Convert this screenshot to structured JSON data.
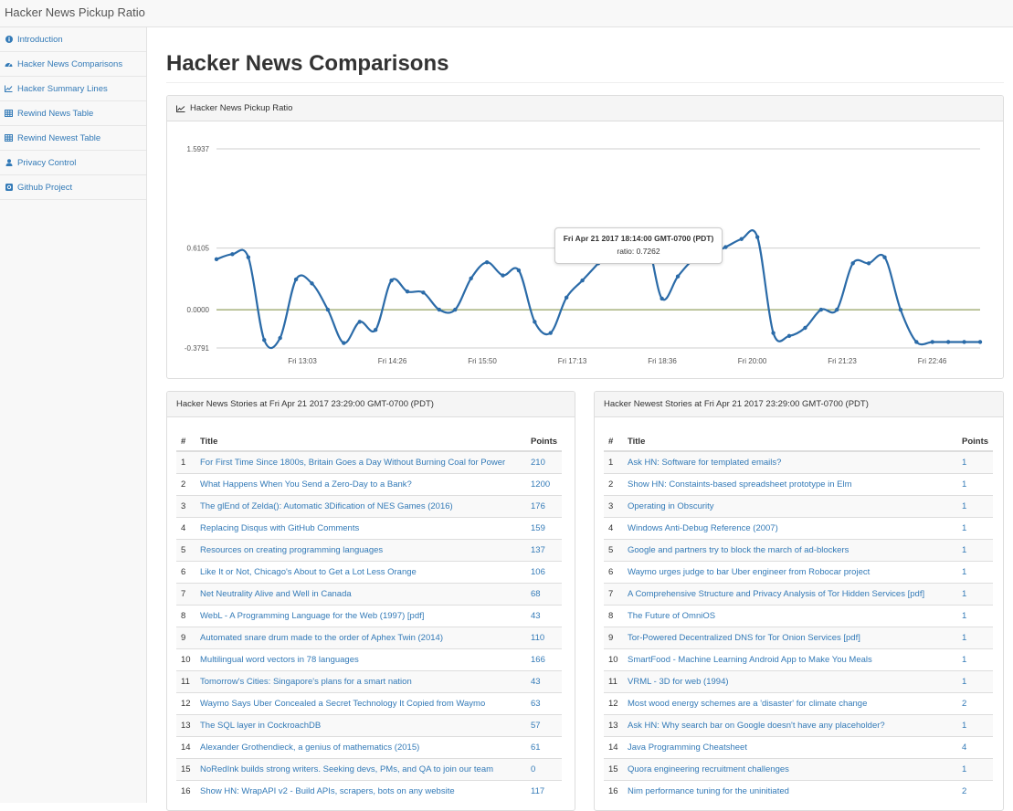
{
  "app": {
    "title": "Hacker News Pickup Ratio"
  },
  "sidebar": {
    "items": [
      {
        "label": "Introduction",
        "icon": "info-icon"
      },
      {
        "label": "Hacker News Comparisons",
        "icon": "dashboard-icon"
      },
      {
        "label": "Hacker Summary Lines",
        "icon": "line-chart-icon"
      },
      {
        "label": "Rewind News Table",
        "icon": "table-icon"
      },
      {
        "label": "Rewind Newest Table",
        "icon": "table-icon"
      },
      {
        "label": "Privacy Control",
        "icon": "user-icon"
      },
      {
        "label": "Github Project",
        "icon": "github-icon"
      }
    ]
  },
  "main": {
    "title": "Hacker News Comparisons"
  },
  "chart_panel": {
    "heading": "Hacker News Pickup Ratio"
  },
  "chart_data": {
    "type": "line",
    "title": "",
    "xlabel": "",
    "ylabel": "",
    "yticks": [
      "1.5937",
      "0.6105",
      "0.0000",
      "-0.3791"
    ],
    "ylim": [
      -0.3791,
      1.5937
    ],
    "xticks": [
      "Fri 13:03",
      "Fri 14:26",
      "Fri 15:50",
      "Fri 17:13",
      "Fri 18:36",
      "Fri 20:00",
      "Fri 21:23",
      "Fri 22:46"
    ],
    "grid": true,
    "line_color": "#2b6ba8",
    "series": [
      {
        "values": [
          0.5,
          0.55,
          0.52,
          -0.3,
          -0.28,
          0.3,
          0.26,
          0.0,
          -0.33,
          -0.12,
          -0.2,
          0.29,
          0.18,
          0.17,
          0.0,
          0.0,
          0.31,
          0.47,
          0.34,
          0.39,
          -0.12,
          -0.23,
          0.12,
          0.29,
          0.46,
          0.64,
          0.65,
          0.7262,
          0.11,
          0.33,
          0.5,
          0.55,
          0.62,
          0.7,
          0.72,
          -0.23,
          -0.26,
          -0.18,
          0.0,
          0.0,
          0.46,
          0.46,
          0.52,
          0.0,
          -0.32,
          -0.32,
          -0.32,
          -0.32,
          -0.32
        ]
      }
    ],
    "tooltip": {
      "date": "Fri Apr 21 2017 18:14:00 GMT-0700 (PDT)",
      "text": "ratio: 0.7262",
      "point_index": 27
    }
  },
  "stories": {
    "heading": "Hacker News Stories at Fri Apr 21 2017 23:29:00 GMT-0700 (PDT)",
    "columns": [
      "#",
      "Title",
      "Points"
    ],
    "rows": [
      [
        "1",
        "For First Time Since 1800s, Britain Goes a Day Without Burning Coal for Power",
        "210"
      ],
      [
        "2",
        "What Happens When You Send a Zero-Day to a Bank?",
        "1200"
      ],
      [
        "3",
        "The glEnd of Zelda(): Automatic 3Dification of NES Games (2016)",
        "176"
      ],
      [
        "4",
        "Replacing Disqus with GitHub Comments",
        "159"
      ],
      [
        "5",
        "Resources on creating programming languages",
        "137"
      ],
      [
        "6",
        "Like It or Not, Chicago's About to Get a Lot Less Orange",
        "106"
      ],
      [
        "7",
        "Net Neutrality Alive and Well in Canada",
        "68"
      ],
      [
        "8",
        "WebL - A Programming Language for the Web (1997) [pdf]",
        "43"
      ],
      [
        "9",
        "Automated snare drum made to the order of Aphex Twin (2014)",
        "110"
      ],
      [
        "10",
        "Multilingual word vectors in 78 languages",
        "166"
      ],
      [
        "11",
        "Tomorrow's Cities: Singapore's plans for a smart nation",
        "43"
      ],
      [
        "12",
        "Waymo Says Uber Concealed a Secret Technology It Copied from Waymo",
        "63"
      ],
      [
        "13",
        "The SQL layer in CockroachDB",
        "57"
      ],
      [
        "14",
        "Alexander Grothendieck, a genius of mathematics (2015)",
        "61"
      ],
      [
        "15",
        "NoRedInk builds strong writers. Seeking devs, PMs, and QA to join our team",
        "0"
      ],
      [
        "16",
        "Show HN: WrapAPI v2 - Build APIs, scrapers, bots on any website",
        "117"
      ]
    ]
  },
  "newest": {
    "heading": "Hacker Newest Stories at Fri Apr 21 2017 23:29:00 GMT-0700 (PDT)",
    "columns": [
      "#",
      "Title",
      "Points"
    ],
    "rows": [
      [
        "1",
        "Ask HN: Software for templated emails?",
        "1"
      ],
      [
        "2",
        "Show HN: Constaints-based spreadsheet prototype in Elm",
        "1"
      ],
      [
        "3",
        "Operating in Obscurity",
        "1"
      ],
      [
        "4",
        "Windows Anti-Debug Reference (2007)",
        "1"
      ],
      [
        "5",
        "Google and partners try to block the march of ad-blockers",
        "1"
      ],
      [
        "6",
        "Waymo urges judge to bar Uber engineer from Robocar project",
        "1"
      ],
      [
        "7",
        "A Comprehensive Structure and Privacy Analysis of Tor Hidden Services [pdf]",
        "1"
      ],
      [
        "8",
        "The Future of OmniOS",
        "1"
      ],
      [
        "9",
        "Tor-Powered Decentralized DNS for Tor Onion Services [pdf]",
        "1"
      ],
      [
        "10",
        "SmartFood - Machine Learning Android App to Make You Meals",
        "1"
      ],
      [
        "11",
        "VRML - 3D for web (1994)",
        "1"
      ],
      [
        "12",
        "Most wood energy schemes are a 'disaster' for climate change",
        "2"
      ],
      [
        "13",
        "Ask HN: Why search bar on Google doesn't have any placeholder?",
        "1"
      ],
      [
        "14",
        "Java Programming Cheatsheet",
        "4"
      ],
      [
        "15",
        "Quora engineering recruitment challenges",
        "1"
      ],
      [
        "16",
        "Nim performance tuning for the uninitiated",
        "2"
      ]
    ]
  }
}
